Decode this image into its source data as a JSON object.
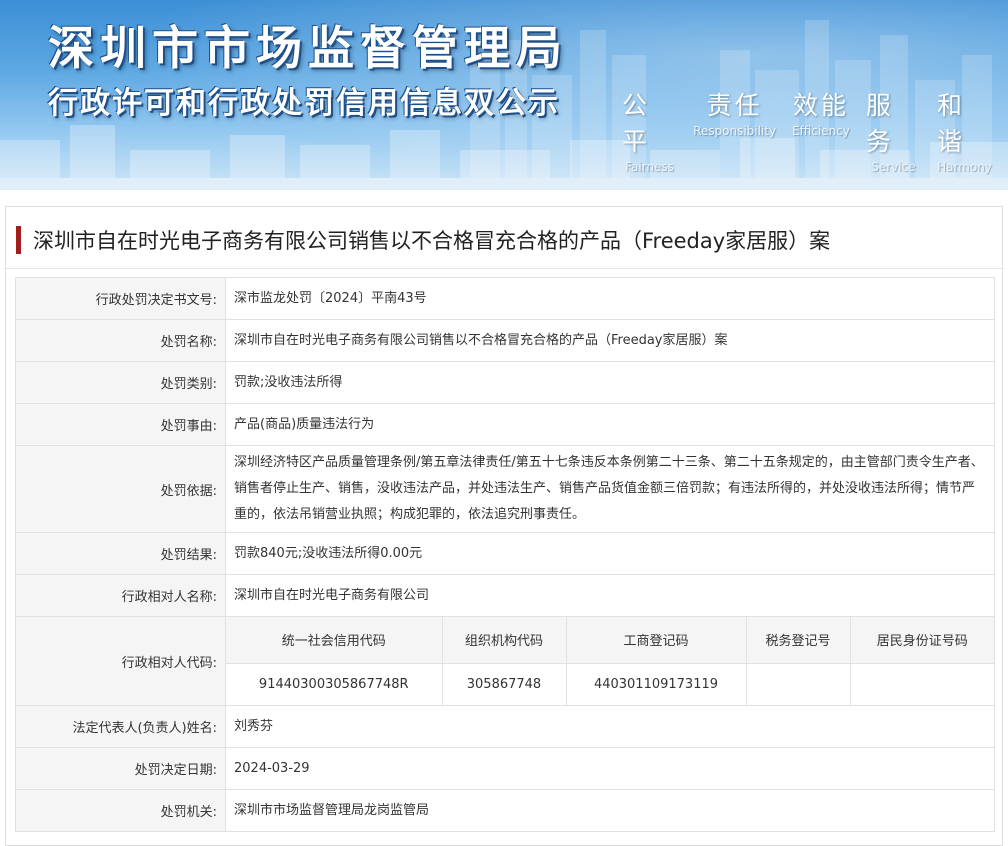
{
  "banner": {
    "title": "深圳市市场监督管理局",
    "subtitle": "行政许可和行政处罚信用信息双公示",
    "values": [
      {
        "zh": "公平",
        "en": "Fairness"
      },
      {
        "zh": "责任",
        "en": "Responsibility"
      },
      {
        "zh": "效能",
        "en": "Efficiency"
      },
      {
        "zh": "服务",
        "en": "Service"
      },
      {
        "zh": "和谐",
        "en": "Harmony"
      }
    ]
  },
  "case_title": "深圳市自在时光电子商务有限公司销售以不合格冒充合格的产品（Freeday家居服）案",
  "rows": {
    "decision_no": {
      "label": "行政处罚决定书文号:",
      "value": "深市监龙处罚〔2024〕平南43号"
    },
    "penalty_name": {
      "label": "处罚名称:",
      "value": "深圳市自在时光电子商务有限公司销售以不合格冒充合格的产品（Freeday家居服）案"
    },
    "penalty_type": {
      "label": "处罚类别:",
      "value": "罚款;没收违法所得"
    },
    "penalty_reason": {
      "label": "处罚事由:",
      "value": "产品(商品)质量违法行为"
    },
    "penalty_basis": {
      "label": "处罚依据:",
      "value": "深圳经济特区产品质量管理条例/第五章法律责任/第五十七条违反本条例第二十三条、第二十五条规定的，由主管部门责令生产者、销售者停止生产、销售，没收违法产品，并处违法生产、销售产品货值金额三倍罚款；有违法所得的，并处没收违法所得；情节严重的，依法吊销营业执照；构成犯罪的，依法追究刑事责任。"
    },
    "penalty_result": {
      "label": "处罚结果:",
      "value": "罚款840元;没收违法所得0.00元"
    },
    "party_name": {
      "label": "行政相对人名称:",
      "value": "深圳市自在时光电子商务有限公司"
    },
    "party_code": {
      "label": "行政相对人代码:"
    },
    "legal_rep": {
      "label": "法定代表人(负责人)姓名:",
      "value": "刘秀芬"
    },
    "decision_date": {
      "label": "处罚决定日期:",
      "value": "2024-03-29"
    },
    "authority": {
      "label": "处罚机关:",
      "value": "深圳市市场监督管理局龙岗监管局"
    }
  },
  "codes": {
    "headers": [
      "统一社会信用代码",
      "组织机构代码",
      "工商登记码",
      "税务登记号",
      "居民身份证号码"
    ],
    "values": [
      "91440300305867748R",
      "305867748",
      "440301109173119",
      "",
      ""
    ]
  }
}
